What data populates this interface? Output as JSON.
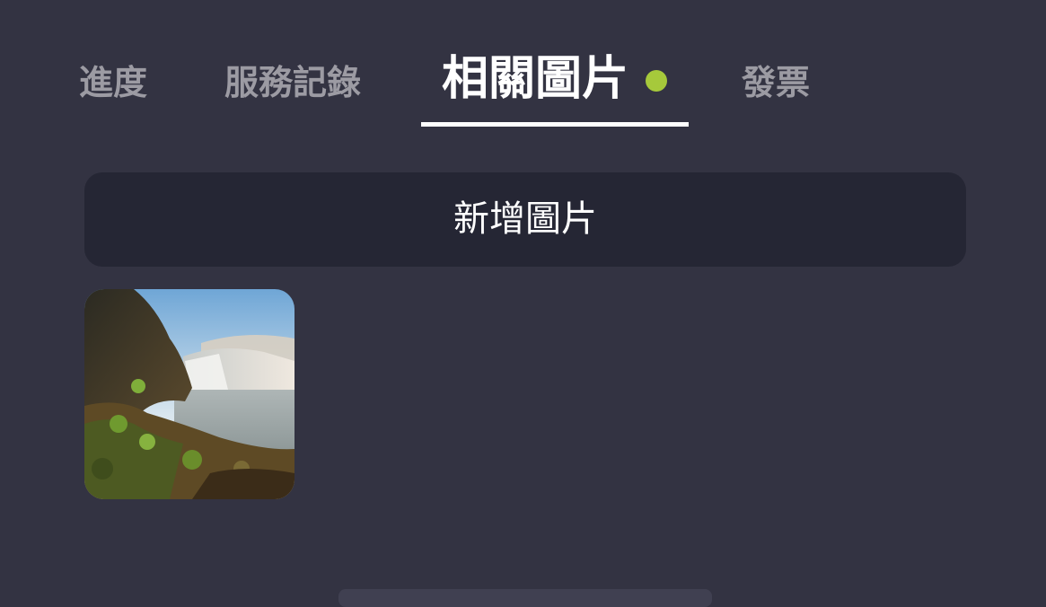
{
  "tabs": [
    {
      "label": "進度",
      "active": false
    },
    {
      "label": "服務記錄",
      "active": false
    },
    {
      "label": "相關圖片",
      "active": true,
      "has_indicator": true
    },
    {
      "label": "發票",
      "active": false
    }
  ],
  "add_image_button": {
    "label": "新增圖片"
  },
  "gallery": {
    "images": [
      {
        "subject": "waterfall landscape"
      }
    ]
  },
  "colors": {
    "background": "#333342",
    "button_bg": "#252634",
    "indicator": "#a6c93b",
    "active_text": "#ffffff",
    "inactive_text": "#9c9ba3"
  }
}
